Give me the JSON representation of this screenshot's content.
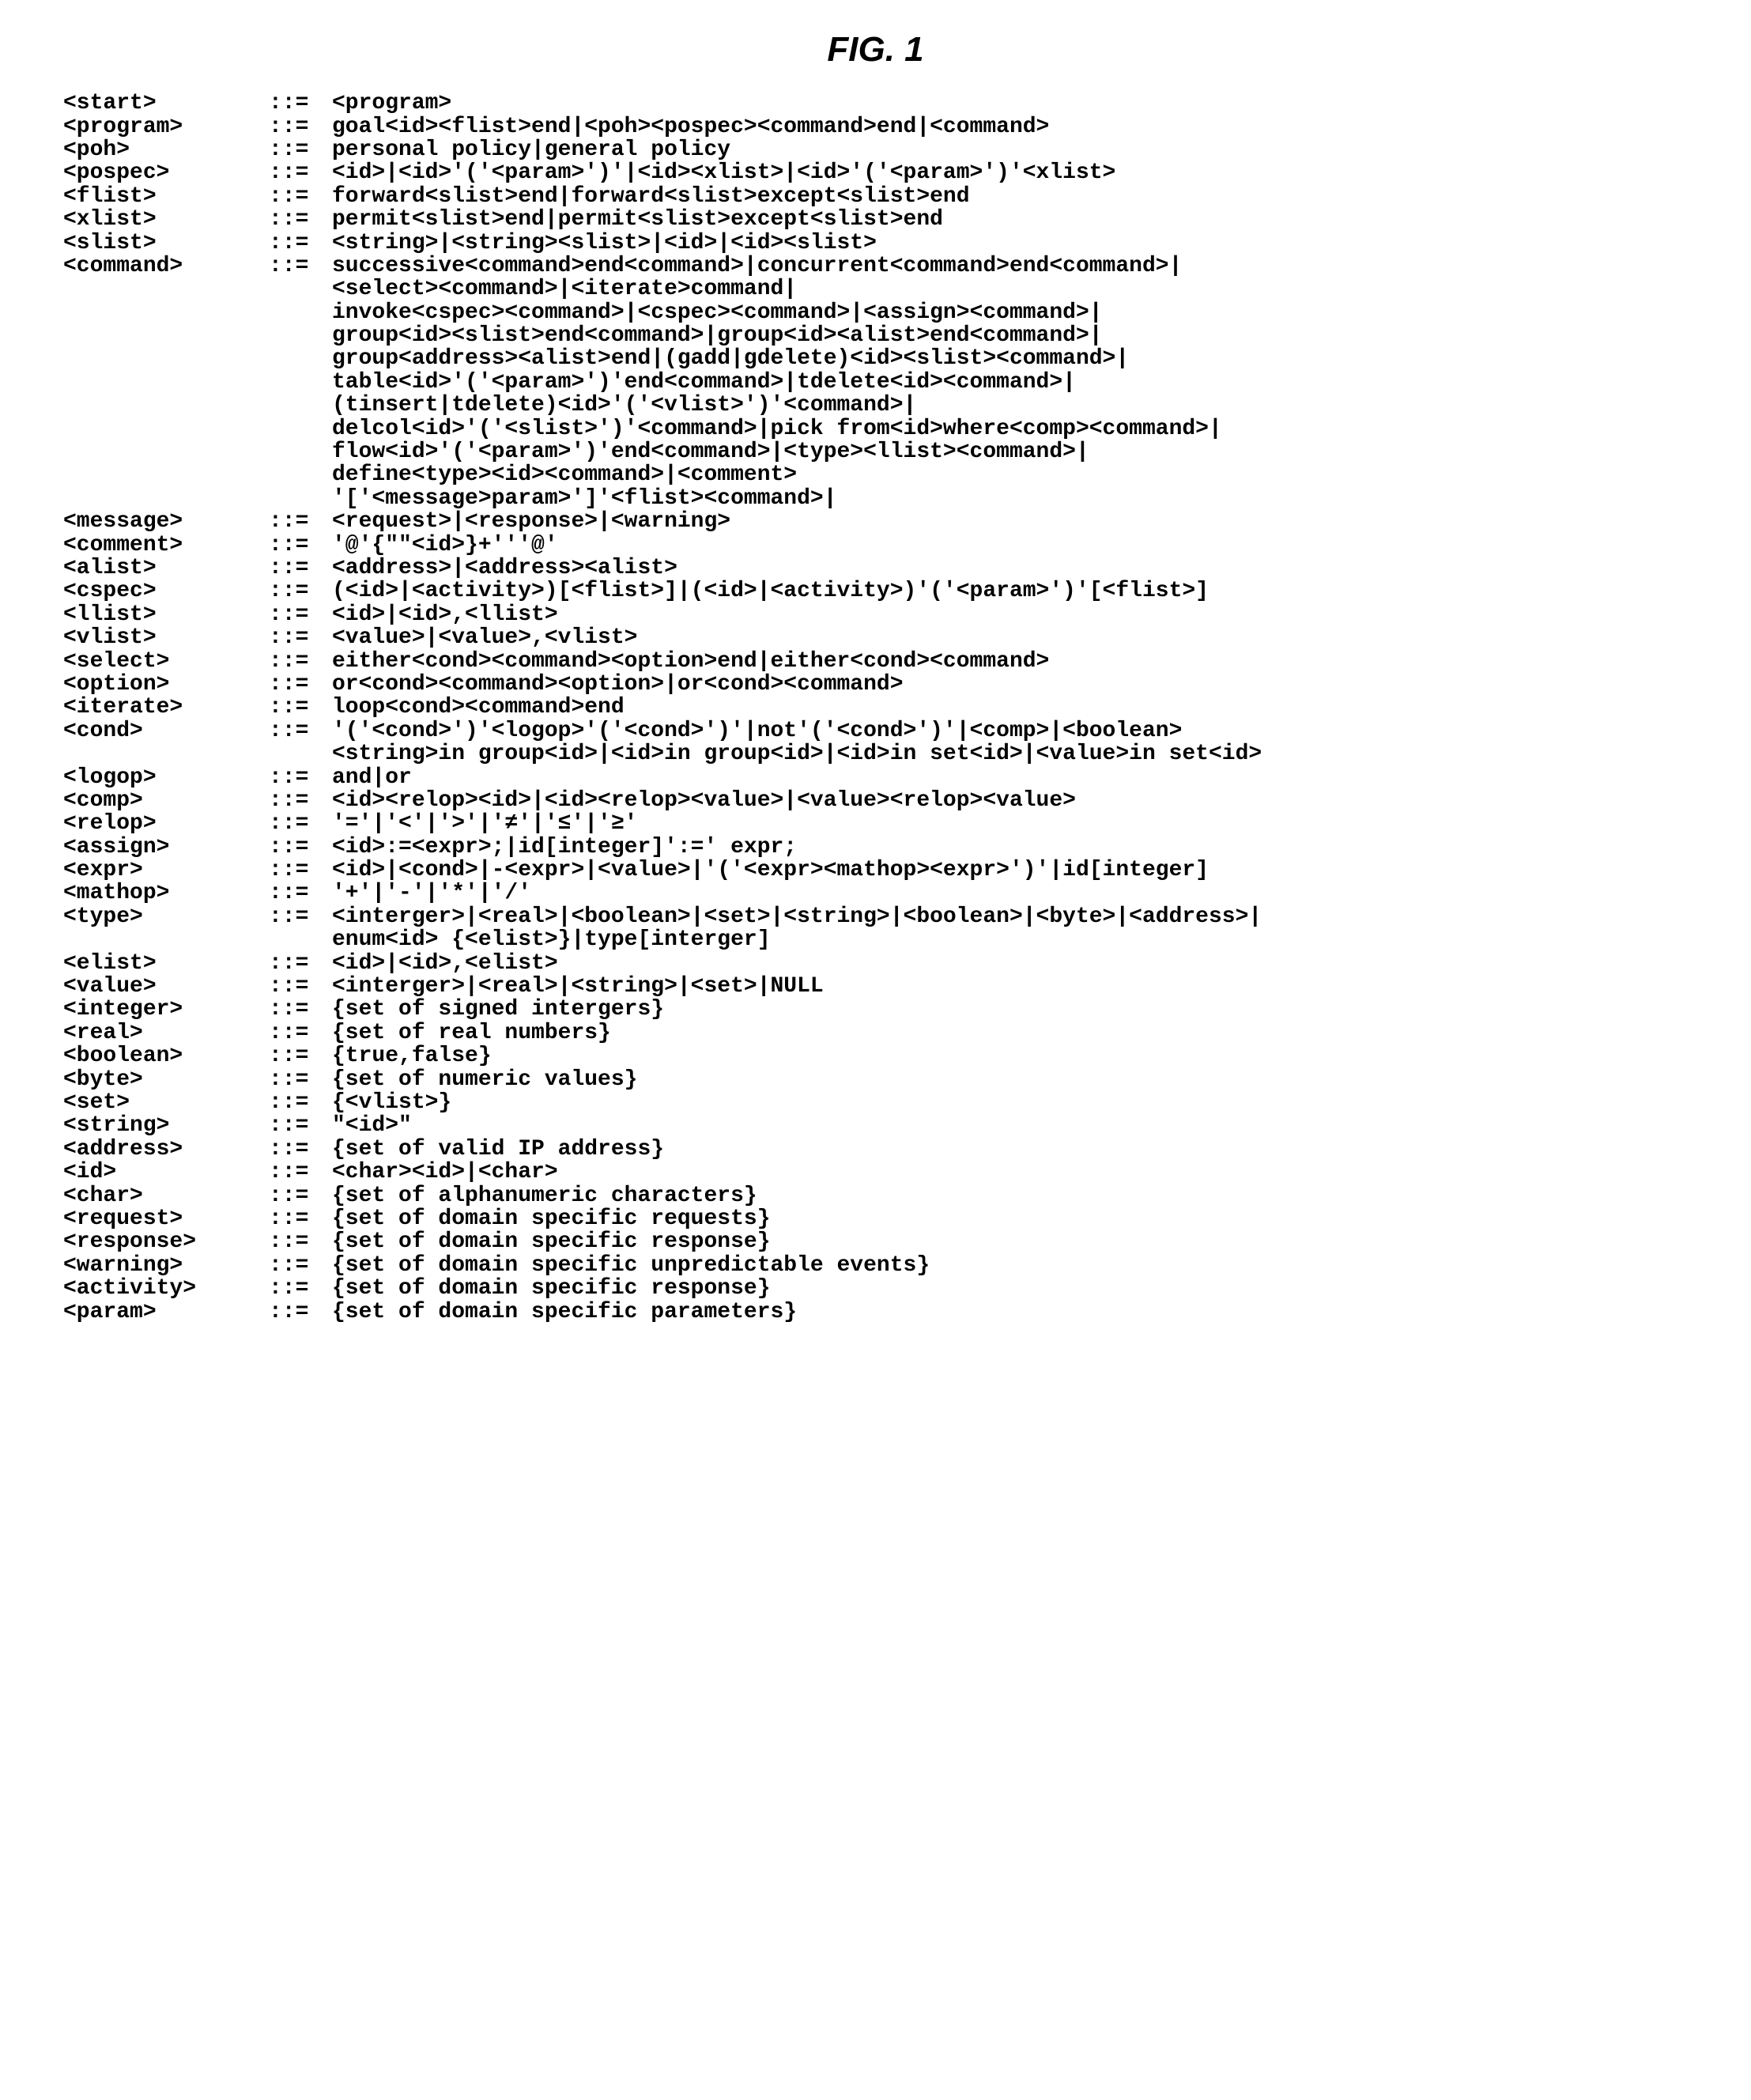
{
  "title": "FIG. 1",
  "rules": [
    {
      "lhs": "<start>",
      "op": "::=",
      "rhs": "<program>"
    },
    {
      "lhs": "<program>",
      "op": "::=",
      "rhs": "goal<id><flist>end|<poh><pospec><command>end|<command>"
    },
    {
      "lhs": "<poh>",
      "op": "::=",
      "rhs": "personal policy|general policy"
    },
    {
      "lhs": "<pospec>",
      "op": "::=",
      "rhs": "<id>|<id>'('<param>')'|<id><xlist>|<id>'('<param>')'<xlist>"
    },
    {
      "lhs": "<flist>",
      "op": "::=",
      "rhs": "forward<slist>end|forward<slist>except<slist>end"
    },
    {
      "lhs": "<xlist>",
      "op": "::=",
      "rhs": "permit<slist>end|permit<slist>except<slist>end"
    },
    {
      "lhs": "<slist>",
      "op": "::=",
      "rhs": "<string>|<string><slist>|<id>|<id><slist>"
    },
    {
      "lhs": "<command>",
      "op": "::=",
      "rhs": "successive<command>end<command>|concurrent<command>end<command>|"
    },
    {
      "cont": "<select><command>|<iterate>command|"
    },
    {
      "cont": "invoke<cspec><command>|<cspec><command>|<assign><command>|"
    },
    {
      "cont": "group<id><slist>end<command>|group<id><alist>end<command>|"
    },
    {
      "cont": "group<address><alist>end|(gadd|gdelete)<id><slist><command>|"
    },
    {
      "cont": "table<id>'('<param>')'end<command>|tdelete<id><command>|"
    },
    {
      "cont": "(tinsert|tdelete)<id>'('<vlist>')'<command>|"
    },
    {
      "cont": "delcol<id>'('<slist>')'<command>|pick from<id>where<comp><command>|"
    },
    {
      "cont": "flow<id>'('<param>')'end<command>|<type><llist><command>|"
    },
    {
      "cont": "define<type><id><command>|<comment>"
    },
    {
      "cont": "'['<message>param>']'<flist><command>|"
    },
    {
      "lhs": "<message>",
      "op": "::=",
      "rhs": "<request>|<response>|<warning>"
    },
    {
      "lhs": "<comment>",
      "op": "::=",
      "rhs": "'@'{\"\"<id>}+'''@'"
    },
    {
      "lhs": "<alist>",
      "op": "::=",
      "rhs": "<address>|<address><alist>"
    },
    {
      "lhs": "<cspec>",
      "op": "::=",
      "rhs": "(<id>|<activity>)[<flist>]|(<id>|<activity>)'('<param>')'[<flist>]"
    },
    {
      "lhs": "<llist>",
      "op": "::=",
      "rhs": "<id>|<id>,<llist>"
    },
    {
      "lhs": "<vlist>",
      "op": "::=",
      "rhs": "<value>|<value>,<vlist>"
    },
    {
      "lhs": "<select>",
      "op": "::=",
      "rhs": "either<cond><command><option>end|either<cond><command>"
    },
    {
      "lhs": "<option>",
      "op": "::=",
      "rhs": "or<cond><command><option>|or<cond><command>"
    },
    {
      "lhs": "<iterate>",
      "op": "::=",
      "rhs": "loop<cond><command>end"
    },
    {
      "lhs": "<cond>",
      "op": "::=",
      "rhs": "'('<cond>')'<logop>'('<cond>')'|not'('<cond>')'|<comp>|<boolean>"
    },
    {
      "cont": "<string>in group<id>|<id>in group<id>|<id>in set<id>|<value>in set<id>"
    },
    {
      "lhs": "<logop>",
      "op": "::=",
      "rhs": "and|or"
    },
    {
      "lhs": "<comp>",
      "op": "::=",
      "rhs": "<id><relop><id>|<id><relop><value>|<value><relop><value>"
    },
    {
      "lhs": "<relop>",
      "op": "::=",
      "rhs": "'='|'<'|'>'|'≠'|'≤'|'≥'"
    },
    {
      "lhs": "<assign>",
      "op": "::=",
      "rhs": "<id>:=<expr>;|id[integer]':=' expr;"
    },
    {
      "lhs": "<expr>",
      "op": "::=",
      "rhs": "<id>|<cond>|-<expr>|<value>|'('<expr><mathop><expr>')'|id[integer]"
    },
    {
      "lhs": "<mathop>",
      "op": "::=",
      "rhs": "'+'|'-'|'*'|'/'"
    },
    {
      "lhs": "<type>",
      "op": "::=",
      "rhs": "<interger>|<real>|<boolean>|<set>|<string>|<boolean>|<byte>|<address>|"
    },
    {
      "cont": "enum<id> {<elist>}|type[interger]"
    },
    {
      "lhs": "<elist>",
      "op": "::=",
      "rhs": "<id>|<id>,<elist>"
    },
    {
      "lhs": "<value>",
      "op": "::=",
      "rhs": "<interger>|<real>|<string>|<set>|NULL"
    },
    {
      "lhs": "<integer>",
      "op": "::=",
      "rhs": "{set of signed intergers}"
    },
    {
      "lhs": "<real>",
      "op": "::=",
      "rhs": "{set of real numbers}"
    },
    {
      "lhs": "<boolean>",
      "op": "::=",
      "rhs": "{true,false}"
    },
    {
      "lhs": "<byte>",
      "op": "::=",
      "rhs": "{set of numeric values}"
    },
    {
      "lhs": "<set>",
      "op": "::=",
      "rhs": "{<vlist>}"
    },
    {
      "lhs": "<string>",
      "op": "::=",
      "rhs": "\"<id>\""
    },
    {
      "lhs": "<address>",
      "op": "::=",
      "rhs": "{set of valid IP address}"
    },
    {
      "lhs": "<id>",
      "op": "::=",
      "rhs": "<char><id>|<char>"
    },
    {
      "lhs": "<char>",
      "op": "::=",
      "rhs": "{set of alphanumeric characters}"
    },
    {
      "lhs": "<request>",
      "op": "::=",
      "rhs": "{set of domain specific requests}"
    },
    {
      "lhs": "<response>",
      "op": "::=",
      "rhs": "{set of domain specific response}"
    },
    {
      "lhs": "<warning>",
      "op": "::=",
      "rhs": "{set of domain specific unpredictable events}"
    },
    {
      "lhs": "<activity>",
      "op": "::=",
      "rhs": "{set of domain specific response}"
    },
    {
      "lhs": "<param>",
      "op": "::=",
      "rhs": "{set of domain specific parameters}"
    }
  ]
}
